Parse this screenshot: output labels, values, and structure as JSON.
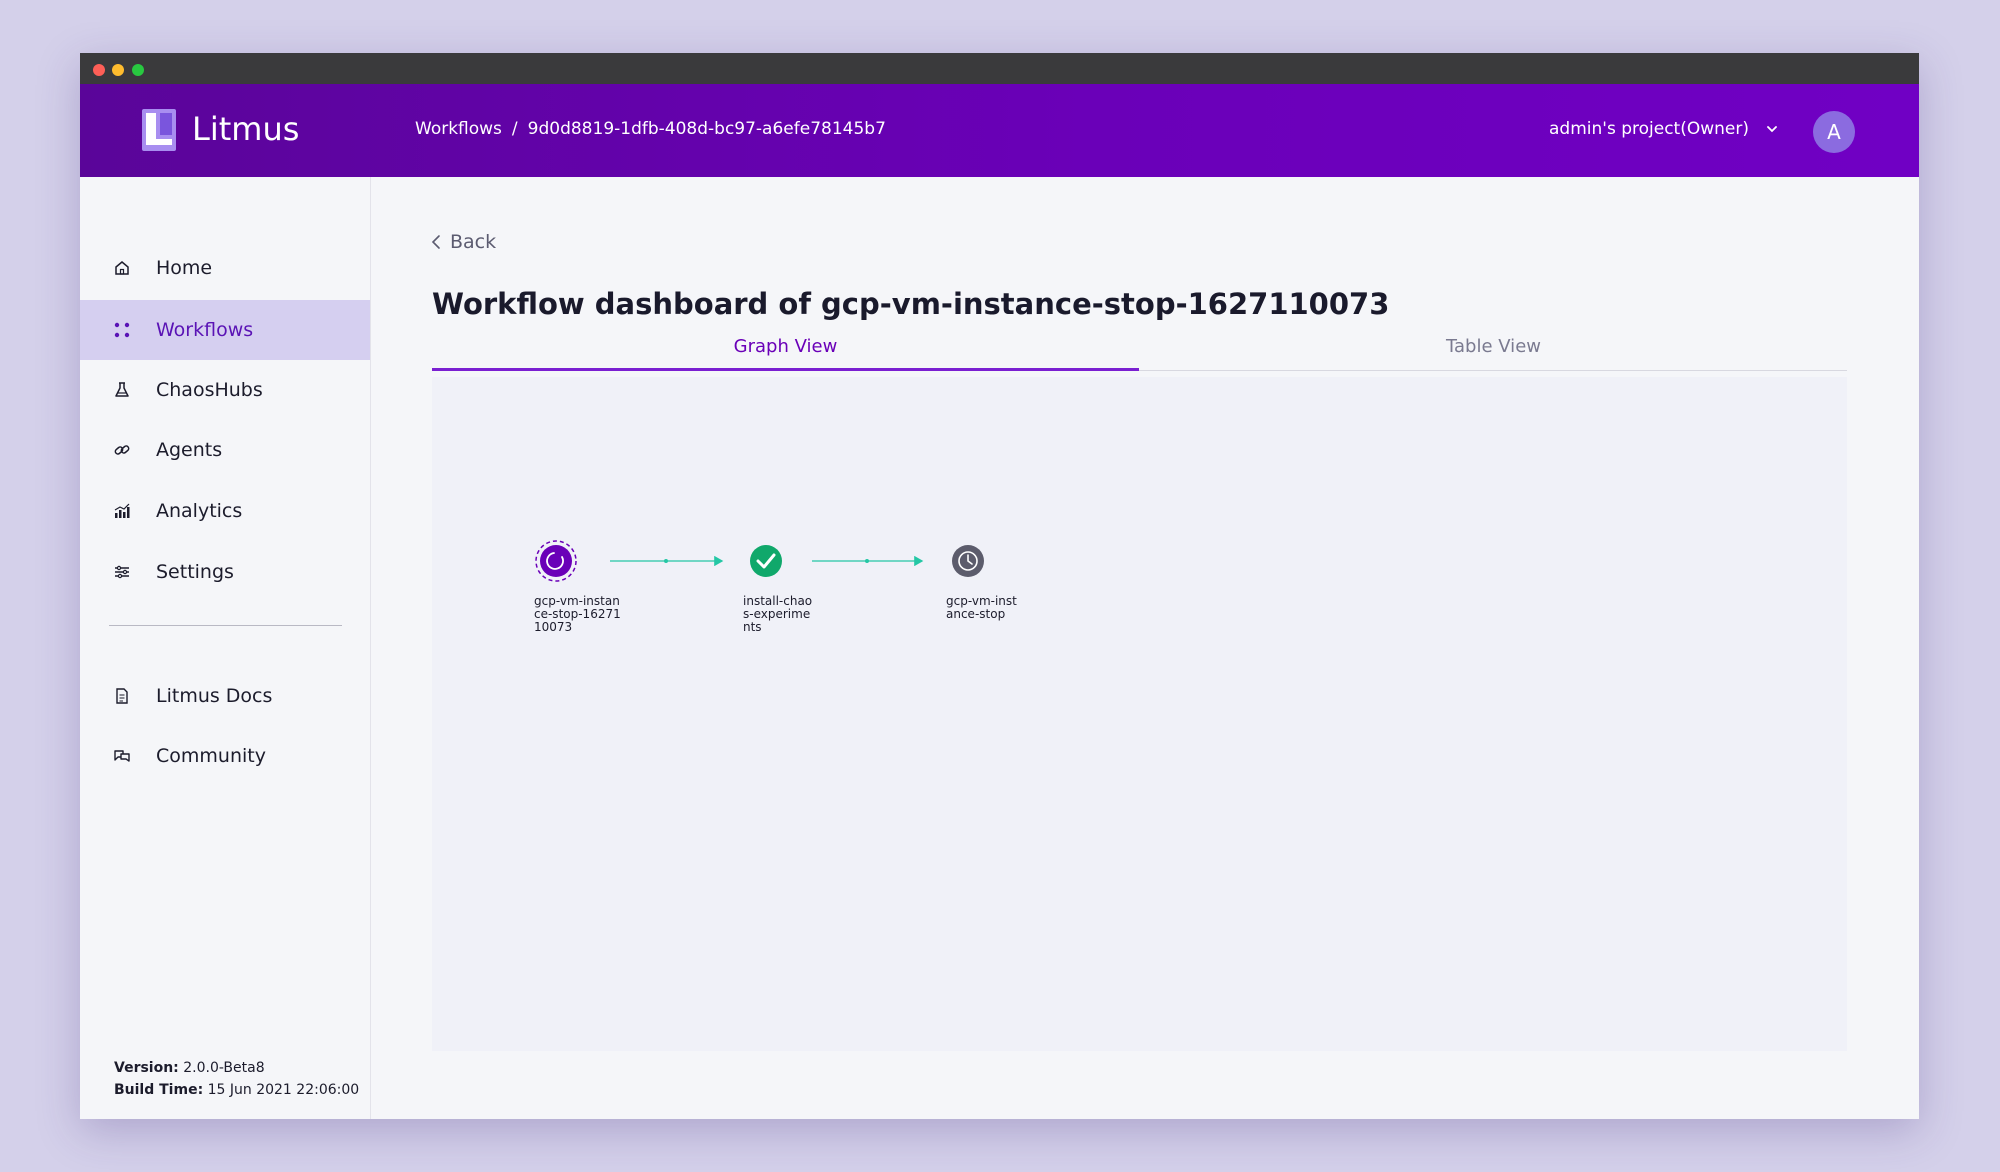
{
  "app": {
    "brand": "Litmus"
  },
  "breadcrumb": {
    "workflows": "Workflows",
    "separator": "/",
    "workflow_id": "9d0d8819-1dfb-408d-bc97-a6efe78145b7"
  },
  "header": {
    "project": "admin's project(Owner)",
    "avatar_initial": "A"
  },
  "sidebar": {
    "items": [
      {
        "label": "Home",
        "icon": "home-icon"
      },
      {
        "label": "Workflows",
        "icon": "workflows-icon",
        "active": true
      },
      {
        "label": "ChaosHubs",
        "icon": "flask-icon"
      },
      {
        "label": "Agents",
        "icon": "link-icon"
      },
      {
        "label": "Analytics",
        "icon": "analytics-icon"
      },
      {
        "label": "Settings",
        "icon": "settings-icon"
      },
      {
        "label": "Litmus Docs",
        "icon": "doc-icon"
      },
      {
        "label": "Community",
        "icon": "chat-icon"
      }
    ],
    "version_label": "Version:",
    "version_value": "2.0.0-Beta8",
    "build_label": "Build Time:",
    "build_value": "15 Jun 2021 22:06:00"
  },
  "main": {
    "back_label": "Back",
    "title": "Workflow dashboard of gcp-vm-instance-stop-1627110073",
    "tabs": [
      {
        "label": "Graph View",
        "active": true
      },
      {
        "label": "Table View",
        "active": false
      }
    ]
  },
  "graph": {
    "nodes": [
      {
        "label": "gcp-vm-instance-stop-1627110073",
        "status": "running"
      },
      {
        "label": "install-chaos-experiments",
        "status": "succeeded"
      },
      {
        "label": "gcp-vm-instance-stop",
        "status": "pending"
      }
    ]
  },
  "colors": {
    "accent": "#6a00b8",
    "active_nav_bg": "#d5cff0",
    "running": "#6a00b8",
    "succeeded": "#10a86b",
    "pending": "#5c5c6c",
    "edge": "#24c7a5"
  }
}
